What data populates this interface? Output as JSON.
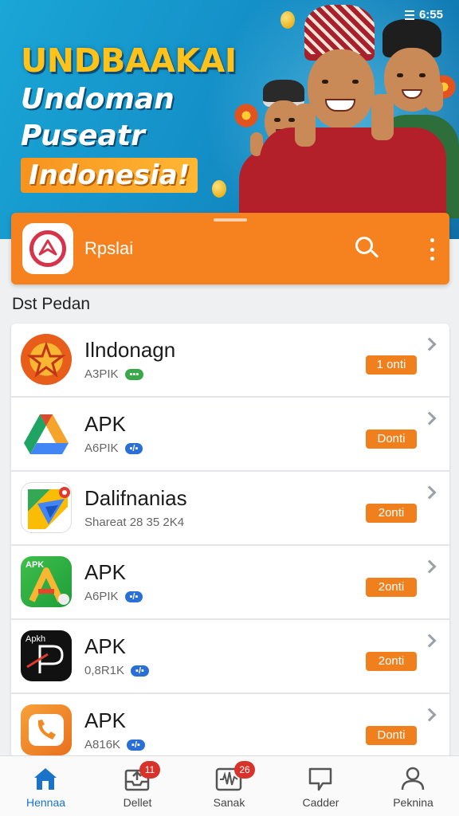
{
  "status_bar": {
    "time": "6:55"
  },
  "banner": {
    "line1": "UNDBAAKAI",
    "line2": "Undoman",
    "line3": "Puseatr",
    "line4": "Indonesia!"
  },
  "app_bar": {
    "title": "Rpslai",
    "icons": [
      "app-logo",
      "search-icon",
      "more-vert-icon"
    ]
  },
  "section": {
    "title": "Dst Pedan"
  },
  "apps": [
    {
      "name": "Ilndonagn",
      "sub": "A3PIK",
      "tag": "▪▪▪",
      "tag_color": "#3aa84a",
      "action": "1 onti",
      "icon": "star-icon"
    },
    {
      "name": "APK",
      "sub": "A6PIK",
      "tag": "▪/▪",
      "tag_color": "#2a6fd6",
      "action": "Donti",
      "icon": "drive-triangle-icon"
    },
    {
      "name": "Dalifnanias",
      "sub": "Shareat 28 35 2K4",
      "tag": "",
      "tag_color": "#2a6fd6",
      "action": "2onti",
      "icon": "maps-icon"
    },
    {
      "name": "APK",
      "sub": "A6PIK",
      "tag": "▪/▪",
      "tag_color": "#2a6fd6",
      "action": "2onti",
      "icon": "apk-a-icon"
    },
    {
      "name": "APK",
      "sub": "0,8R1K",
      "tag": "▪/▪",
      "tag_color": "#2a6fd6",
      "action": "2onti",
      "icon": "apk-p-icon"
    },
    {
      "name": "APK",
      "sub": "A816K",
      "tag": "▪/▪",
      "tag_color": "#2a6fd6",
      "action": "Donti",
      "icon": "phone-icon"
    }
  ],
  "bottom_nav": [
    {
      "label": "Hennaa",
      "icon": "home-icon",
      "badge": "",
      "active": true
    },
    {
      "label": "Dellet",
      "icon": "inbox-upload-icon",
      "badge": "11",
      "active": false
    },
    {
      "label": "Sanak",
      "icon": "waveform-icon",
      "badge": "26",
      "active": false
    },
    {
      "label": "Cadder",
      "icon": "message-icon",
      "badge": "",
      "active": false
    },
    {
      "label": "Peknina",
      "icon": "person-icon",
      "badge": "",
      "active": false
    }
  ],
  "colors": {
    "accent": "#f5821f",
    "banner": "#1490c8",
    "active": "#1a73c8",
    "badge": "#d8332a"
  }
}
